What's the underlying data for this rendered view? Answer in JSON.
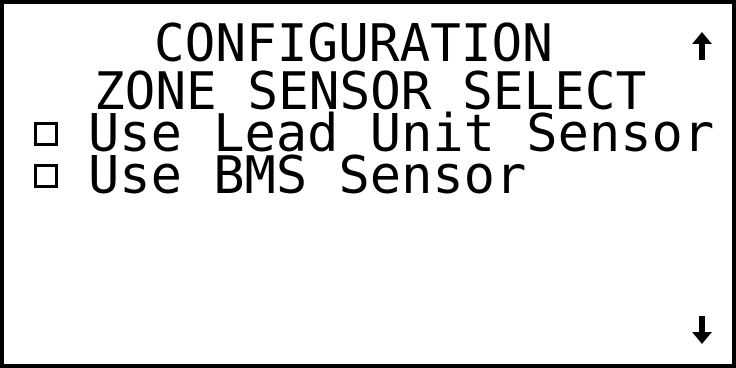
{
  "screen": {
    "title": "CONFIGURATION",
    "subtitle": "ZONE SENSOR SELECT",
    "options": [
      {
        "label": "Use Lead Unit Sensor",
        "checked": false
      },
      {
        "label": "Use BMS Sensor",
        "checked": false
      }
    ],
    "scroll_up_icon": "arrow-up-icon",
    "scroll_down_icon": "arrow-down-icon"
  },
  "colors": {
    "background": "#ffffff",
    "foreground": "#000000"
  }
}
